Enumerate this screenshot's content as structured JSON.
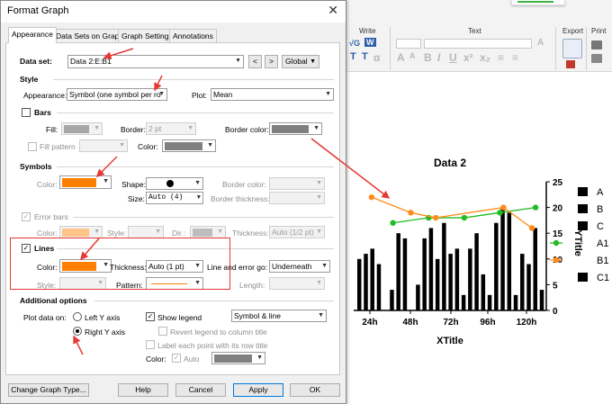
{
  "dialog": {
    "title": "Format Graph",
    "close": "✕",
    "tabs": [
      "Appearance",
      "Data Sets on Graph",
      "Graph Settings",
      "Annotations"
    ],
    "dataset": {
      "label": "Data set:",
      "value": "Data 2:E:B1",
      "prev": "<",
      "next": ">",
      "scope": "Global"
    },
    "style": {
      "heading": "Style",
      "appearance_label": "Appearance:",
      "appearance_value": "Symbol (one symbol per ro",
      "plot_label": "Plot:",
      "plot_value": "Mean"
    },
    "bars": {
      "heading": "Bars",
      "fill_label": "Fill:",
      "border_label": "Border:",
      "border_value": "2 pt",
      "border_color_label": "Border color:",
      "fill_pattern_label": "Fill pattern",
      "color_label": "Color:"
    },
    "symbols": {
      "heading": "Symbols",
      "color_label": "Color:",
      "shape_label": "Shape:",
      "border_color_label": "Border color:",
      "size_label": "Size:",
      "size_value": "Auto (4)",
      "border_thickness_label": "Border thickness:"
    },
    "error_bars": {
      "heading": "Error bars",
      "color_label": "Color:",
      "style_label": "Style:",
      "dir_label": "Dir.:",
      "thickness_label": "Thickness:",
      "thickness_value": "Auto (1/2 pt)"
    },
    "lines": {
      "heading": "Lines",
      "color_label": "Color:",
      "thickness_label": "Thickness:",
      "thickness_value": "Auto (1 pt)",
      "line_error_label": "Line and error go:",
      "line_error_value": "Underneath",
      "style_label": "Style:",
      "pattern_label": "Pattern:",
      "length_label": "Length:"
    },
    "additional": {
      "heading": "Additional options",
      "plot_on_label": "Plot data on:",
      "left_axis": "Left Y axis",
      "right_axis": "Right  Y axis",
      "show_legend": "Show legend",
      "legend_mode": "Symbol & line",
      "revert_legend": "Revert legend to column title",
      "label_each": "Label each point with its row title",
      "color_label": "Color:",
      "auto_label": "Auto"
    },
    "buttons": {
      "change_type": "Change Graph Type...",
      "help": "Help",
      "cancel": "Cancel",
      "apply": "Apply",
      "ok": "OK"
    },
    "colors": {
      "symbol_color": "#ff8000",
      "line_color": "#ff8000",
      "bar_fill": "#a6a6a6",
      "bar_border_color": "#808080",
      "pattern_color": "#808080",
      "label_color": "#808080"
    }
  },
  "ribbon": {
    "write_label": "Write",
    "text_label": "Text",
    "export_label": "Export",
    "print_label": "Print",
    "write_buttons": [
      "√G",
      "W",
      "T",
      "T",
      "α"
    ],
    "text_glyphs": [
      "A",
      "A",
      "B",
      "I",
      "U",
      "x²",
      "x₂",
      "≡",
      "≡",
      "A"
    ]
  },
  "chart_data": {
    "type": "bar",
    "title": "Data 2",
    "xlabel": "XTitle",
    "ylabel": "YTitle",
    "x_ticks": [
      "24h",
      "48h",
      "72h",
      "96h",
      "120h"
    ],
    "y_ticks": [
      0,
      5,
      10,
      15,
      20,
      25
    ],
    "ylim": [
      0,
      25
    ],
    "legend": [
      "A",
      "B",
      "C",
      "A1",
      "B1",
      "C1"
    ],
    "legend_colors": [
      "#000000",
      "#000000",
      "#000000",
      "#22bb22",
      "#ff8c1a",
      "#000000"
    ],
    "bars": [
      10,
      11,
      12,
      9,
      0,
      4,
      15,
      14,
      0,
      5,
      14,
      16,
      10,
      17,
      11,
      12,
      3,
      12,
      15,
      7,
      3,
      17,
      20,
      19,
      3,
      11,
      9,
      16,
      4
    ],
    "series": [
      {
        "name": "A1",
        "color": "#22bb22",
        "points": [
          [
            1,
            17
          ],
          [
            2,
            18
          ],
          [
            3,
            18
          ],
          [
            4,
            19
          ],
          [
            5,
            20
          ]
        ]
      },
      {
        "name": "B1",
        "color": "#ff8c1a",
        "points": [
          [
            0.4,
            22
          ],
          [
            1.5,
            19
          ],
          [
            2.2,
            18
          ],
          [
            4.1,
            20
          ],
          [
            4.9,
            16
          ]
        ]
      }
    ]
  }
}
